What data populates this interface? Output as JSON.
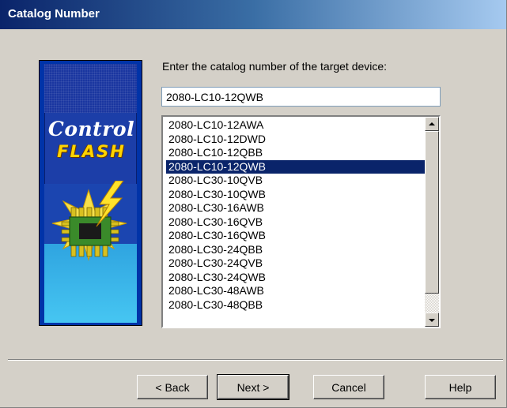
{
  "window": {
    "title": "Catalog Number"
  },
  "banner": {
    "line1": "Control",
    "line2": "FLASH"
  },
  "prompt": "Enter the catalog number of the target device:",
  "catalog_input": {
    "value": "2080-LC10-12QWB"
  },
  "catalog_list": {
    "selected_index": 3,
    "items": [
      "2080-LC10-12AWA",
      "2080-LC10-12DWD",
      "2080-LC10-12QBB",
      "2080-LC10-12QWB",
      "2080-LC30-10QVB",
      "2080-LC30-10QWB",
      "2080-LC30-16AWB",
      "2080-LC30-16QVB",
      "2080-LC30-16QWB",
      "2080-LC30-24QBB",
      "2080-LC30-24QVB",
      "2080-LC30-24QWB",
      "2080-LC30-48AWB",
      "2080-LC30-48QBB"
    ]
  },
  "buttons": {
    "back": "< Back",
    "next": "Next >",
    "cancel": "Cancel",
    "help": "Help"
  },
  "colors": {
    "titlebar": "#0a246a",
    "selection": "#0a246a",
    "dialog": "#d4d0c8",
    "logo_yellow": "#ffd400"
  }
}
